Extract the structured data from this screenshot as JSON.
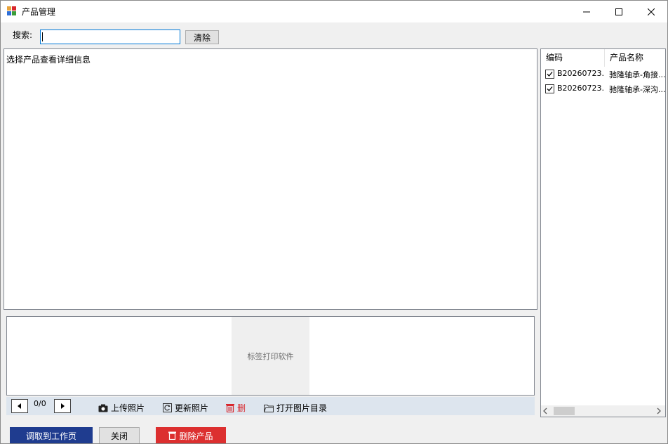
{
  "window": {
    "title": "产品管理"
  },
  "search": {
    "label": "搜索:",
    "value": "",
    "placeholder": "",
    "clear_label": "清除"
  },
  "detail": {
    "text": "选择产品查看详细信息"
  },
  "photo": {
    "placeholder_text": "标签打印软件",
    "counter": "0/0",
    "tools": {
      "upload": "上传照片",
      "refresh": "更新照片",
      "delete": "删",
      "open_dir": "打开图片目录"
    }
  },
  "actions": {
    "fetch": "调取到工作页",
    "close": "关闭",
    "delete_product": "删除产品"
  },
  "product_list": {
    "columns": [
      "编码",
      "产品名称"
    ],
    "rows": [
      {
        "checked": true,
        "code": "B20260723...",
        "name": "驰隆轴承-角接..."
      },
      {
        "checked": true,
        "code": "B20260723...",
        "name": "驰隆轴承-深沟..."
      }
    ]
  },
  "colors": {
    "accent_blue": "#1f3c8f",
    "danger_red": "#dc2f2f",
    "focus_border": "#0078d7"
  },
  "icons": {
    "app": "app-icon",
    "minimize": "minimize-icon",
    "maximize": "maximize-icon",
    "close": "close-icon",
    "camera": "camera-icon",
    "refresh": "refresh-icon",
    "trash": "trash-icon",
    "folder": "folder-icon"
  }
}
